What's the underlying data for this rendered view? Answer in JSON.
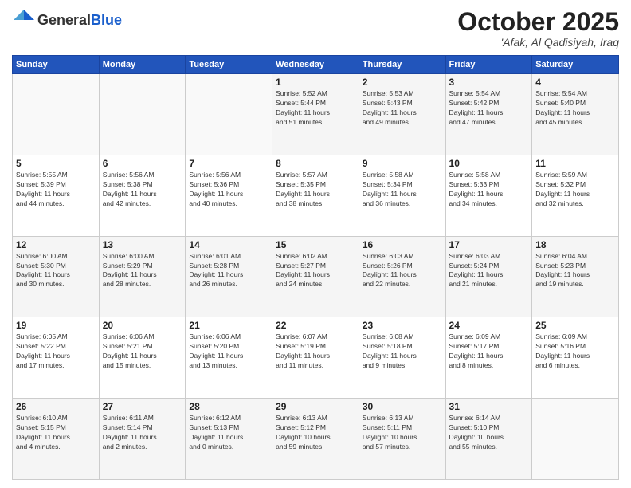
{
  "header": {
    "logo_general": "General",
    "logo_blue": "Blue",
    "month": "October 2025",
    "location": "'Afak, Al Qadisiyah, Iraq"
  },
  "weekdays": [
    "Sunday",
    "Monday",
    "Tuesday",
    "Wednesday",
    "Thursday",
    "Friday",
    "Saturday"
  ],
  "weeks": [
    [
      {
        "day": "",
        "text": ""
      },
      {
        "day": "",
        "text": ""
      },
      {
        "day": "",
        "text": ""
      },
      {
        "day": "1",
        "text": "Sunrise: 5:52 AM\nSunset: 5:44 PM\nDaylight: 11 hours\nand 51 minutes."
      },
      {
        "day": "2",
        "text": "Sunrise: 5:53 AM\nSunset: 5:43 PM\nDaylight: 11 hours\nand 49 minutes."
      },
      {
        "day": "3",
        "text": "Sunrise: 5:54 AM\nSunset: 5:42 PM\nDaylight: 11 hours\nand 47 minutes."
      },
      {
        "day": "4",
        "text": "Sunrise: 5:54 AM\nSunset: 5:40 PM\nDaylight: 11 hours\nand 45 minutes."
      }
    ],
    [
      {
        "day": "5",
        "text": "Sunrise: 5:55 AM\nSunset: 5:39 PM\nDaylight: 11 hours\nand 44 minutes."
      },
      {
        "day": "6",
        "text": "Sunrise: 5:56 AM\nSunset: 5:38 PM\nDaylight: 11 hours\nand 42 minutes."
      },
      {
        "day": "7",
        "text": "Sunrise: 5:56 AM\nSunset: 5:36 PM\nDaylight: 11 hours\nand 40 minutes."
      },
      {
        "day": "8",
        "text": "Sunrise: 5:57 AM\nSunset: 5:35 PM\nDaylight: 11 hours\nand 38 minutes."
      },
      {
        "day": "9",
        "text": "Sunrise: 5:58 AM\nSunset: 5:34 PM\nDaylight: 11 hours\nand 36 minutes."
      },
      {
        "day": "10",
        "text": "Sunrise: 5:58 AM\nSunset: 5:33 PM\nDaylight: 11 hours\nand 34 minutes."
      },
      {
        "day": "11",
        "text": "Sunrise: 5:59 AM\nSunset: 5:32 PM\nDaylight: 11 hours\nand 32 minutes."
      }
    ],
    [
      {
        "day": "12",
        "text": "Sunrise: 6:00 AM\nSunset: 5:30 PM\nDaylight: 11 hours\nand 30 minutes."
      },
      {
        "day": "13",
        "text": "Sunrise: 6:00 AM\nSunset: 5:29 PM\nDaylight: 11 hours\nand 28 minutes."
      },
      {
        "day": "14",
        "text": "Sunrise: 6:01 AM\nSunset: 5:28 PM\nDaylight: 11 hours\nand 26 minutes."
      },
      {
        "day": "15",
        "text": "Sunrise: 6:02 AM\nSunset: 5:27 PM\nDaylight: 11 hours\nand 24 minutes."
      },
      {
        "day": "16",
        "text": "Sunrise: 6:03 AM\nSunset: 5:26 PM\nDaylight: 11 hours\nand 22 minutes."
      },
      {
        "day": "17",
        "text": "Sunrise: 6:03 AM\nSunset: 5:24 PM\nDaylight: 11 hours\nand 21 minutes."
      },
      {
        "day": "18",
        "text": "Sunrise: 6:04 AM\nSunset: 5:23 PM\nDaylight: 11 hours\nand 19 minutes."
      }
    ],
    [
      {
        "day": "19",
        "text": "Sunrise: 6:05 AM\nSunset: 5:22 PM\nDaylight: 11 hours\nand 17 minutes."
      },
      {
        "day": "20",
        "text": "Sunrise: 6:06 AM\nSunset: 5:21 PM\nDaylight: 11 hours\nand 15 minutes."
      },
      {
        "day": "21",
        "text": "Sunrise: 6:06 AM\nSunset: 5:20 PM\nDaylight: 11 hours\nand 13 minutes."
      },
      {
        "day": "22",
        "text": "Sunrise: 6:07 AM\nSunset: 5:19 PM\nDaylight: 11 hours\nand 11 minutes."
      },
      {
        "day": "23",
        "text": "Sunrise: 6:08 AM\nSunset: 5:18 PM\nDaylight: 11 hours\nand 9 minutes."
      },
      {
        "day": "24",
        "text": "Sunrise: 6:09 AM\nSunset: 5:17 PM\nDaylight: 11 hours\nand 8 minutes."
      },
      {
        "day": "25",
        "text": "Sunrise: 6:09 AM\nSunset: 5:16 PM\nDaylight: 11 hours\nand 6 minutes."
      }
    ],
    [
      {
        "day": "26",
        "text": "Sunrise: 6:10 AM\nSunset: 5:15 PM\nDaylight: 11 hours\nand 4 minutes."
      },
      {
        "day": "27",
        "text": "Sunrise: 6:11 AM\nSunset: 5:14 PM\nDaylight: 11 hours\nand 2 minutes."
      },
      {
        "day": "28",
        "text": "Sunrise: 6:12 AM\nSunset: 5:13 PM\nDaylight: 11 hours\nand 0 minutes."
      },
      {
        "day": "29",
        "text": "Sunrise: 6:13 AM\nSunset: 5:12 PM\nDaylight: 10 hours\nand 59 minutes."
      },
      {
        "day": "30",
        "text": "Sunrise: 6:13 AM\nSunset: 5:11 PM\nDaylight: 10 hours\nand 57 minutes."
      },
      {
        "day": "31",
        "text": "Sunrise: 6:14 AM\nSunset: 5:10 PM\nDaylight: 10 hours\nand 55 minutes."
      },
      {
        "day": "",
        "text": ""
      }
    ]
  ]
}
